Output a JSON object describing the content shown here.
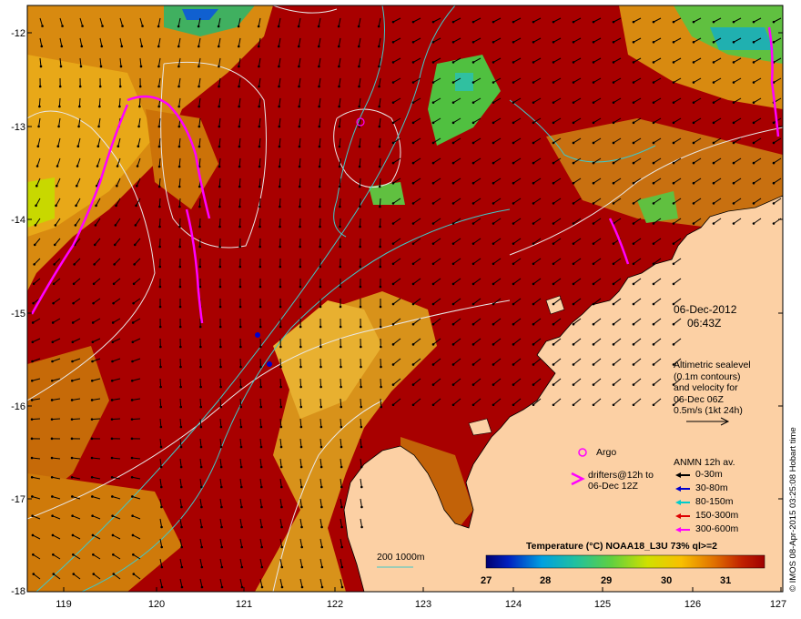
{
  "map": {
    "date": "06-Dec-2012",
    "time": "06:43Z",
    "altimetry_lines": [
      "Altimetric sealevel",
      "(0.1m contours)",
      "and velocity for",
      "06-Dec 06Z",
      "0.5m/s (1kt 24h)"
    ],
    "argo_label": "Argo",
    "drifters_lines": [
      "drifters@12h to",
      "06-Dec 12Z"
    ],
    "anmn_title": "ANMN 12h av.",
    "anmn_depths": [
      {
        "label": "0-30m",
        "color": "#000000"
      },
      {
        "label": "30-80m",
        "color": "#0000cc"
      },
      {
        "label": "80-150m",
        "color": "#00cccc"
      },
      {
        "label": "150-300m",
        "color": "#dd0000"
      },
      {
        "label": "300-600m",
        "color": "#ff00ff"
      }
    ],
    "bathy_label": "200 1000m",
    "colorbar_title": "Temperature (°C) NOAA18_L3U 73% ql>=2",
    "colorbar_ticks": [
      "27",
      "28",
      "29",
      "30",
      "31"
    ],
    "credit": "© IMOS 08-Apr-2015 03:25:08 Hobart time",
    "lat_ticks": [
      "-12",
      "-13",
      "-14",
      "-15",
      "-16",
      "-17",
      "-18"
    ],
    "lon_ticks": [
      "119",
      "120",
      "121",
      "122",
      "123",
      "124",
      "125",
      "126",
      "127"
    ],
    "colors": {
      "ocean": "#a80000",
      "land": "#fcd0a4",
      "drifter": "#ff00ff",
      "contour": "#e8e8e8",
      "bathy": "#40c8c8"
    }
  }
}
